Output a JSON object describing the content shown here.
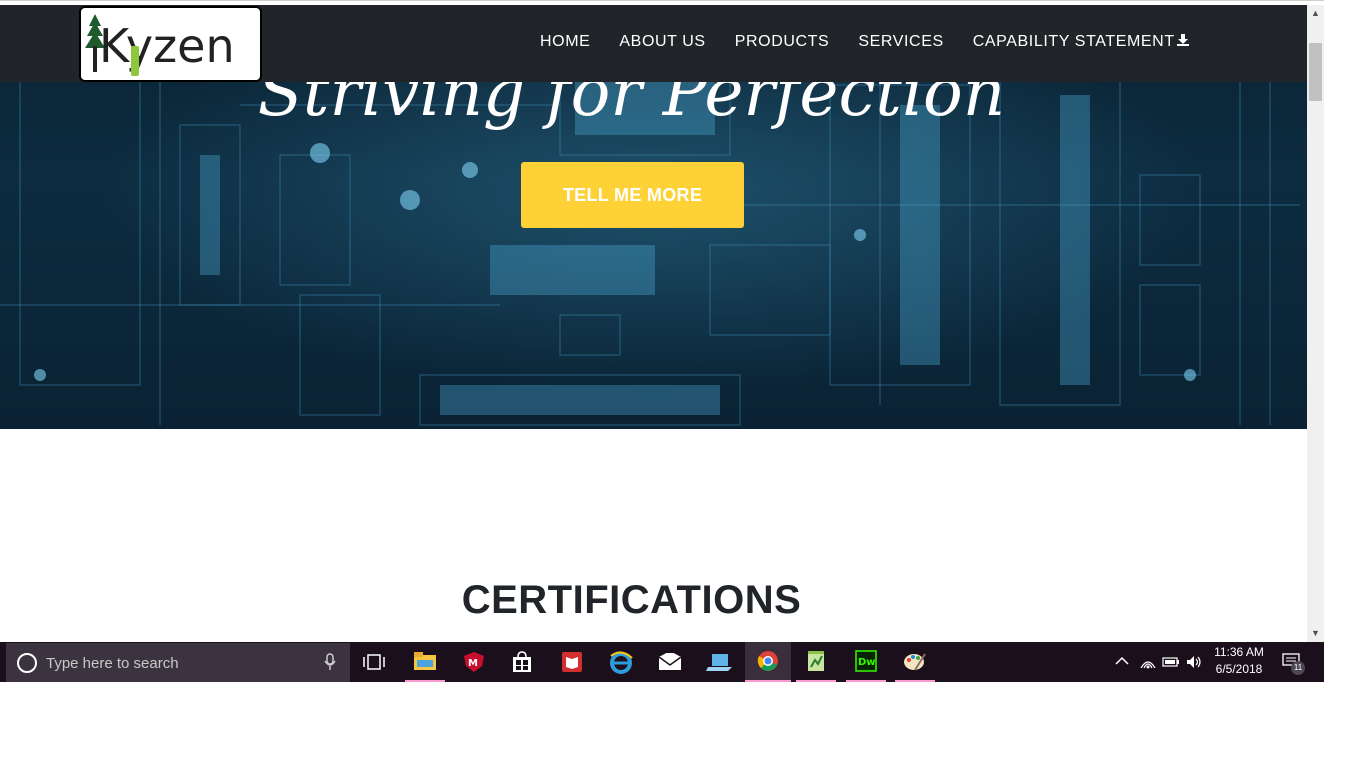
{
  "brand": {
    "logo_text": "Kyzen"
  },
  "nav": {
    "items": [
      {
        "label": "HOME"
      },
      {
        "label": "ABOUT US"
      },
      {
        "label": "PRODUCTS"
      },
      {
        "label": "SERVICES"
      },
      {
        "label": "CAPABILITY STATEMENT"
      }
    ],
    "download_icon": "download-icon"
  },
  "hero": {
    "title": "Striving for Perfection",
    "cta_label": "TELL ME MORE",
    "background": "circuit-board-image"
  },
  "sections": {
    "certifications_title": "CERTIFICATIONS"
  },
  "taskbar": {
    "search_placeholder": "Type here to search",
    "apps": [
      "task-view-icon",
      "file-explorer-icon",
      "mcafee-icon",
      "store-icon",
      "reader-icon",
      "edge-ie-icon",
      "mail-icon",
      "laptop-icon",
      "chrome-icon",
      "notepad-plus-icon",
      "dreamweaver-icon",
      "paint-icon"
    ],
    "time": "11:36 AM",
    "date": "6/5/2018",
    "notification_count": "11"
  },
  "colors": {
    "navbar_bg": "#212529",
    "cta_bg": "#fed136",
    "taskbar_bg": "#1c0f1c",
    "logo_green": "#8dc63f"
  }
}
